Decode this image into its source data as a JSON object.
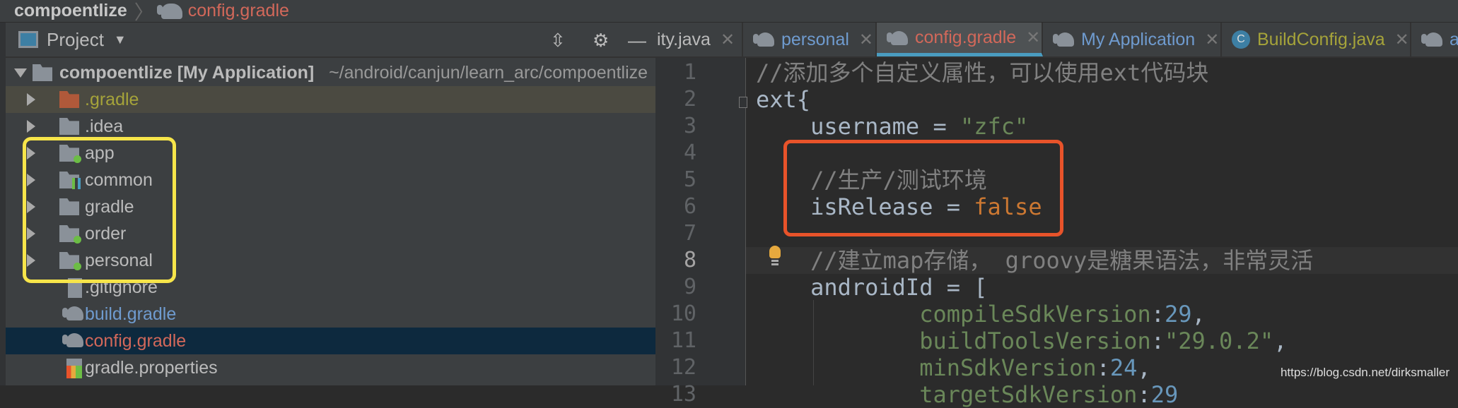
{
  "breadcrumb": {
    "project": "compoentlize",
    "file": "config.gradle"
  },
  "panel": {
    "title": "Project",
    "root": {
      "name": "compoentlize",
      "module": "[My Application]",
      "path": "~/android/canjun/learn_arc/compoentlize"
    },
    "items": [
      {
        "label": ".gradle",
        "type": "folder-orange",
        "expandable": true,
        "color": "#a5a33a"
      },
      {
        "label": ".idea",
        "type": "folder",
        "expandable": true
      },
      {
        "label": "app",
        "type": "module",
        "expandable": true
      },
      {
        "label": "common",
        "type": "library-module",
        "expandable": true
      },
      {
        "label": "gradle",
        "type": "folder",
        "expandable": true
      },
      {
        "label": "order",
        "type": "module",
        "expandable": true
      },
      {
        "label": "personal",
        "type": "module",
        "expandable": true
      },
      {
        "label": ".gitignore",
        "type": "file"
      },
      {
        "label": "build.gradle",
        "type": "gradle",
        "color": "#6f9bcf"
      },
      {
        "label": "config.gradle",
        "type": "gradle",
        "color": "#d2685a",
        "selected": true
      },
      {
        "label": "gradle.properties",
        "type": "properties"
      }
    ]
  },
  "tabs": [
    {
      "label": "ity.java",
      "color": "#bbbbbb"
    },
    {
      "label": "personal",
      "color": "#6f9bcf",
      "icon": "gradle-icon"
    },
    {
      "label": "config.gradle",
      "color": "#d2685a",
      "icon": "gradle-icon",
      "active": true
    },
    {
      "label": "My Application",
      "color": "#6f9bcf",
      "icon": "gradle-icon"
    },
    {
      "label": "BuildConfig.java",
      "color": "#a5a33a",
      "icon": "class-icon"
    },
    {
      "label": "a",
      "color": "#6f9bcf",
      "icon": "gradle-icon"
    }
  ],
  "code": {
    "current_line": 8,
    "lines": [
      [
        {
          "t": "//添加多个自定义属性，可以使用ext代码块",
          "c": "c"
        }
      ],
      [
        {
          "t": "ext{",
          "c": ""
        }
      ],
      [
        {
          "t": "    username = ",
          "c": ""
        },
        {
          "t": "\"zfc\"",
          "c": "s"
        }
      ],
      [],
      [
        {
          "t": "    //生产/测试环境",
          "c": "c"
        }
      ],
      [
        {
          "t": "    isRelease = ",
          "c": ""
        },
        {
          "t": "false",
          "c": "k"
        }
      ],
      [],
      [
        {
          "t": "    //建立map存储， groovy是糖果语法，非常灵活",
          "c": "c"
        }
      ],
      [
        {
          "t": "    androidId = [",
          "c": ""
        }
      ],
      [
        {
          "t": "            compileSdkVersion",
          "c": "p"
        },
        {
          "t": ":",
          "c": ""
        },
        {
          "t": "29",
          "c": "n"
        },
        {
          "t": ",",
          "c": ""
        }
      ],
      [
        {
          "t": "            buildToolsVersion",
          "c": "p"
        },
        {
          "t": ":",
          "c": ""
        },
        {
          "t": "\"29.0.2\"",
          "c": "s"
        },
        {
          "t": ",",
          "c": ""
        }
      ],
      [
        {
          "t": "            minSdkVersion",
          "c": "p"
        },
        {
          "t": ":",
          "c": ""
        },
        {
          "t": "24",
          "c": "n"
        },
        {
          "t": ",",
          "c": ""
        }
      ],
      [
        {
          "t": "            targetSdkVersion",
          "c": "p"
        },
        {
          "t": ":",
          "c": ""
        },
        {
          "t": "29",
          "c": "n"
        }
      ]
    ]
  },
  "watermark": "https://blog.csdn.net/dirksmaller"
}
